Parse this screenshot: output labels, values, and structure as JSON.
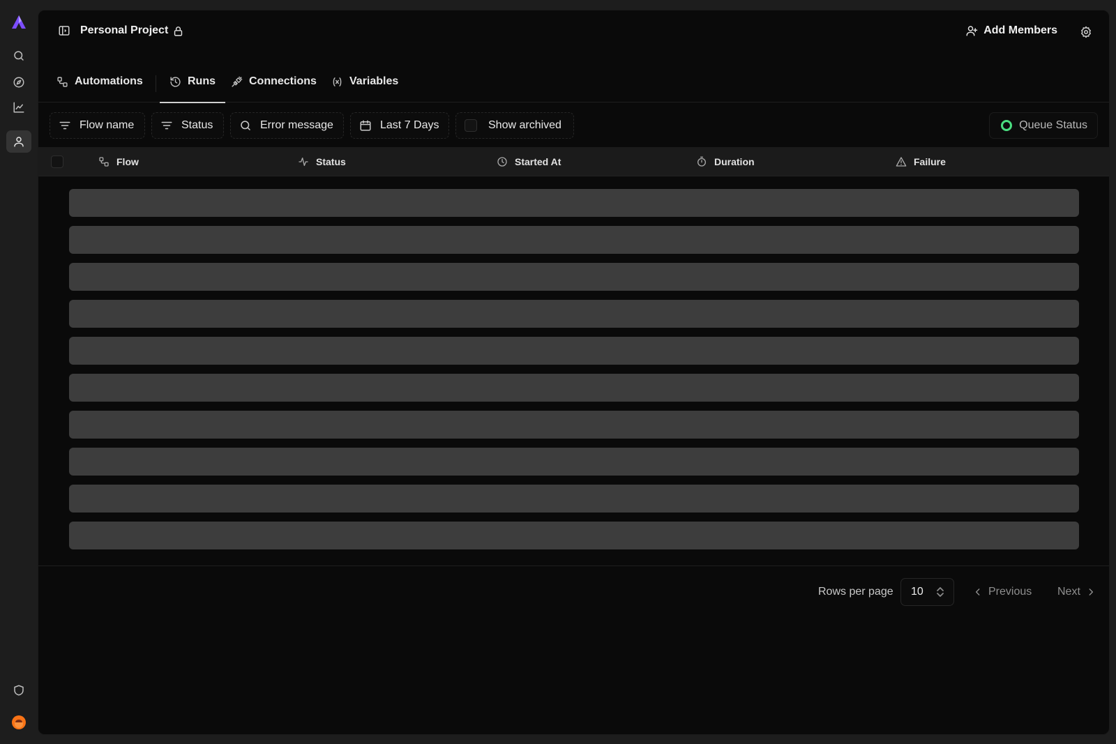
{
  "colors": {
    "background": "#1d1d1d",
    "panel": "#0a0a0a",
    "brand": "#7c4dff",
    "queue_status": "#4ade80",
    "skeleton": "#3d3d3d"
  },
  "sidebar": {
    "items": [
      {
        "icon": "search-icon"
      },
      {
        "icon": "compass-icon"
      },
      {
        "icon": "chart-line-icon"
      },
      {
        "icon": "user-icon",
        "active": true
      }
    ],
    "bottom": [
      {
        "icon": "shield-icon"
      },
      {
        "icon": "user-avatar"
      }
    ]
  },
  "header": {
    "project_name": "Personal Project",
    "project_icon": "lock-icon",
    "add_members_label": "Add Members",
    "settings_icon": "gear-icon"
  },
  "tabs": [
    {
      "label": "Automations",
      "icon": "flow-icon"
    },
    {
      "label": "Runs",
      "icon": "history-icon",
      "active": true
    },
    {
      "label": "Connections",
      "icon": "plug-icon"
    },
    {
      "label": "Variables",
      "icon": "variable-icon"
    }
  ],
  "filters": {
    "flow_name": "Flow name",
    "status": "Status",
    "error_message": "Error message",
    "date_range": "Last 7 Days",
    "show_archived": "Show archived",
    "queue_status": "Queue Status"
  },
  "table": {
    "columns": [
      "Flow",
      "Status",
      "Started At",
      "Duration",
      "Failure"
    ],
    "loading_rows": 10
  },
  "pagination": {
    "rows_per_page_label": "Rows per page",
    "rows_per_page_value": "10",
    "previous_label": "Previous",
    "next_label": "Next"
  }
}
